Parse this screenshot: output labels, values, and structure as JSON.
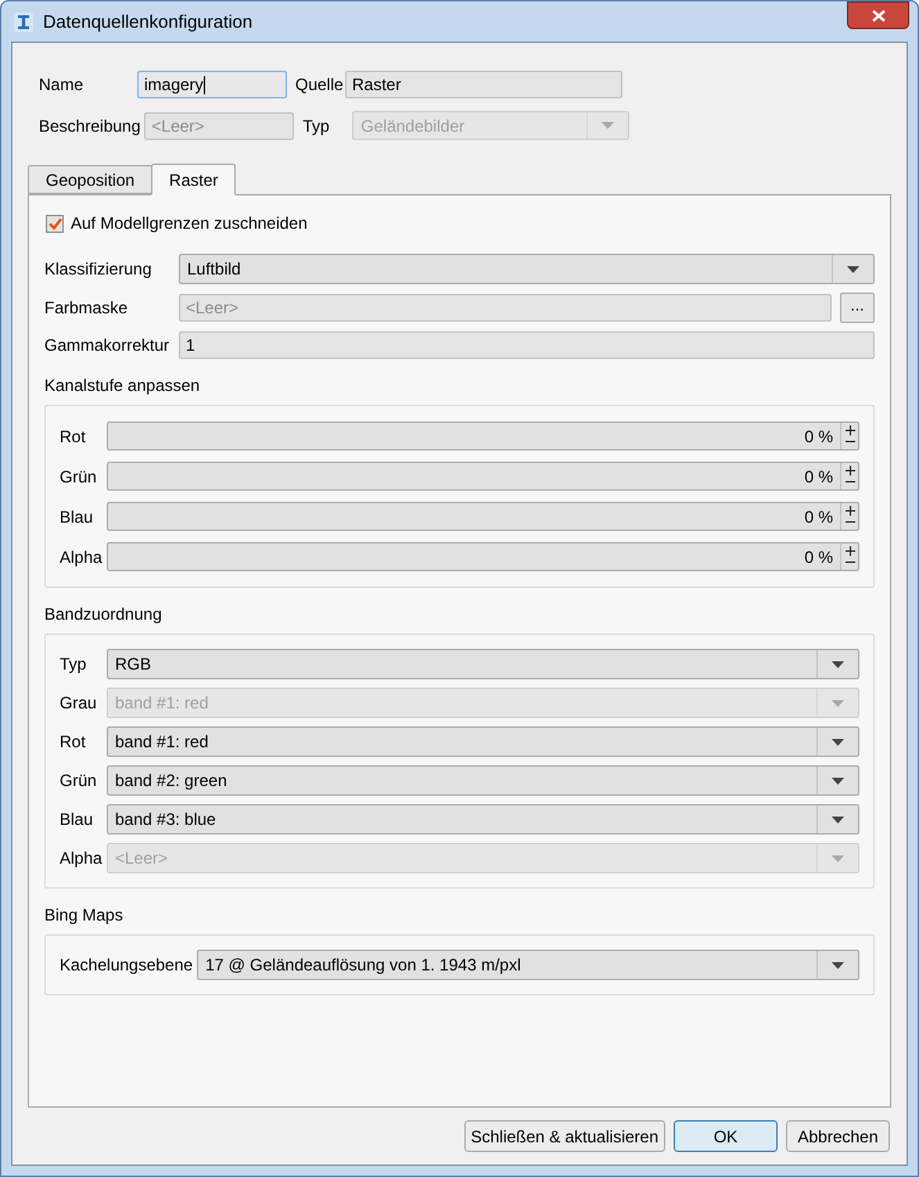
{
  "window": {
    "title": "Datenquellenkonfiguration"
  },
  "header": {
    "name": {
      "label": "Name",
      "value": "imagery",
      "focused": true
    },
    "source": {
      "label": "Quelle",
      "value": "Raster"
    },
    "description": {
      "label": "Beschreibung",
      "placeholder": "<Leer>"
    },
    "type": {
      "label": "Typ",
      "value": "Geländebilder",
      "disabled": true
    }
  },
  "tabs": [
    {
      "label": "Geoposition",
      "selected": false
    },
    {
      "label": "Raster",
      "selected": true
    }
  ],
  "clip_checkbox": {
    "label": "Auf Modellgrenzen zuschneiden",
    "checked": true
  },
  "classification": {
    "label": "Klassifizierung",
    "value": "Luftbild"
  },
  "color_mask": {
    "label": "Farbmaske",
    "placeholder": "<Leer>",
    "browse_button": "..."
  },
  "gamma": {
    "label": "Gammakorrektur",
    "value": "1"
  },
  "channel_levels": {
    "title": "Kanalstufe anpassen",
    "channels": [
      {
        "label": "Rot",
        "value": "0 %"
      },
      {
        "label": "Grün",
        "value": "0 %"
      },
      {
        "label": "Blau",
        "value": "0 %"
      },
      {
        "label": "Alpha",
        "value": "0 %"
      }
    ]
  },
  "band_mapping": {
    "title": "Bandzuordnung",
    "rows": [
      {
        "label": "Typ",
        "value": "RGB",
        "disabled": false
      },
      {
        "label": "Grau",
        "value": "band #1: red",
        "disabled": true
      },
      {
        "label": "Rot",
        "value": "band #1: red",
        "disabled": false
      },
      {
        "label": "Grün",
        "value": "band #2: green",
        "disabled": false
      },
      {
        "label": "Blau",
        "value": "band #3: blue",
        "disabled": false
      },
      {
        "label": "Alpha",
        "value": "<Leer>",
        "disabled": true
      }
    ]
  },
  "bing_maps": {
    "title": "Bing Maps",
    "tiling": {
      "label": "Kachelungsebene",
      "value": "17 @ Geländeauflösung von 1. 1943 m/pxl"
    }
  },
  "buttons": [
    {
      "label": "Schließen & aktualisieren",
      "default": false
    },
    {
      "label": "OK",
      "default": true
    },
    {
      "label": "Abbrechen",
      "default": false
    }
  ]
}
